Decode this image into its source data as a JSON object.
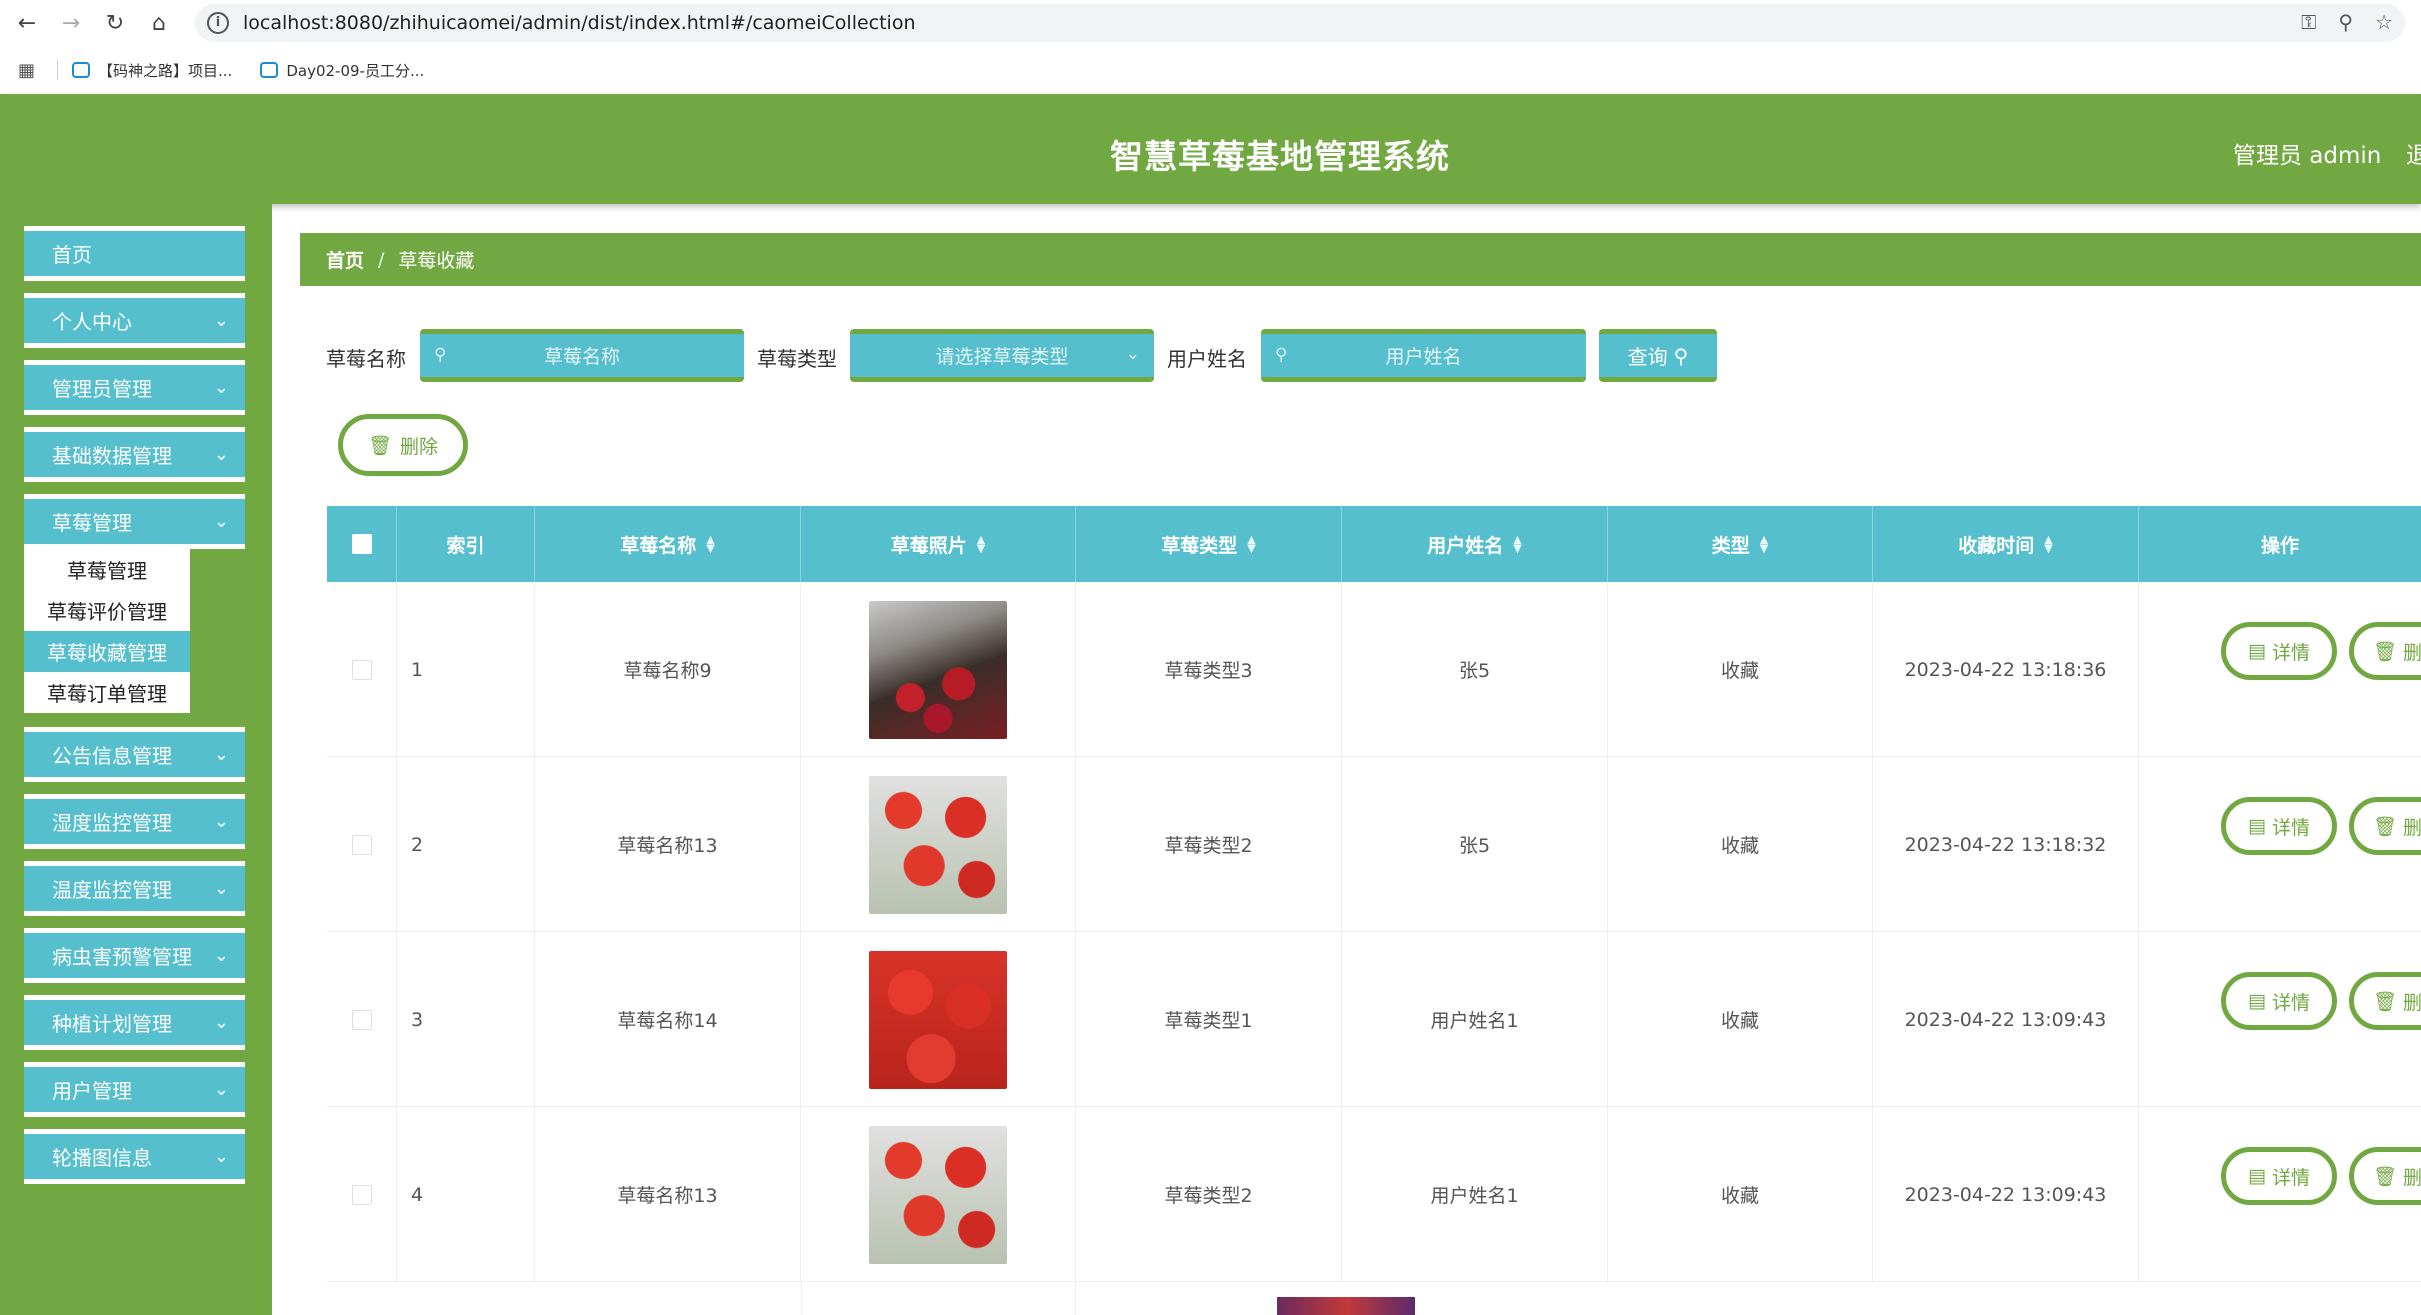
{
  "browser": {
    "url": "localhost:8080/zhihuicaomei/admin/dist/index.html#/caomeiCollection",
    "bookmarks": [
      "【码神之路】项目...",
      "Day02-09-员工分..."
    ]
  },
  "header": {
    "title": "智慧草莓基地管理系统",
    "user": "管理员 admin",
    "logout": "退"
  },
  "sidebar": {
    "items": [
      {
        "label": "首页"
      },
      {
        "label": "个人中心"
      },
      {
        "label": "管理员管理"
      },
      {
        "label": "基础数据管理"
      },
      {
        "label": "草莓管理"
      },
      {
        "label": "公告信息管理"
      },
      {
        "label": "湿度监控管理"
      },
      {
        "label": "温度监控管理"
      },
      {
        "label": "病虫害预警管理"
      },
      {
        "label": "种植计划管理"
      },
      {
        "label": "用户管理"
      },
      {
        "label": "轮播图信息"
      }
    ],
    "submenu": [
      "草莓管理",
      "草莓评价管理",
      "草莓收藏管理",
      "草莓订单管理"
    ]
  },
  "breadcrumb": {
    "home": "首页",
    "separator": "/",
    "current": "草莓收藏"
  },
  "search": {
    "name_label": "草莓名称",
    "name_placeholder": "草莓名称",
    "type_label": "草莓类型",
    "type_placeholder": "请选择草莓类型",
    "user_label": "用户姓名",
    "user_placeholder": "用户姓名",
    "query_label": "查询"
  },
  "actions": {
    "delete_label": "删除"
  },
  "table": {
    "columns": [
      "索引",
      "草莓名称",
      "草莓照片",
      "草莓类型",
      "用户姓名",
      "类型",
      "收藏时间",
      "操作"
    ],
    "rows": [
      {
        "index": "1",
        "name": "草莓名称9",
        "type": "草莓类型3",
        "user": "张5",
        "kind": "收藏",
        "time": "2023-04-22 13:18:36"
      },
      {
        "index": "2",
        "name": "草莓名称13",
        "type": "草莓类型2",
        "user": "张5",
        "kind": "收藏",
        "time": "2023-04-22 13:18:32"
      },
      {
        "index": "3",
        "name": "草莓名称14",
        "type": "草莓类型1",
        "user": "用户姓名1",
        "kind": "收藏",
        "time": "2023-04-22 13:09:43"
      },
      {
        "index": "4",
        "name": "草莓名称13",
        "type": "草莓类型2",
        "user": "用户姓名1",
        "kind": "收藏",
        "time": "2023-04-22 13:09:43"
      }
    ],
    "detail_label": "详情",
    "delete_label": "删除"
  },
  "colors": {
    "primary_green": "#72a842",
    "teal": "#56bfce"
  }
}
